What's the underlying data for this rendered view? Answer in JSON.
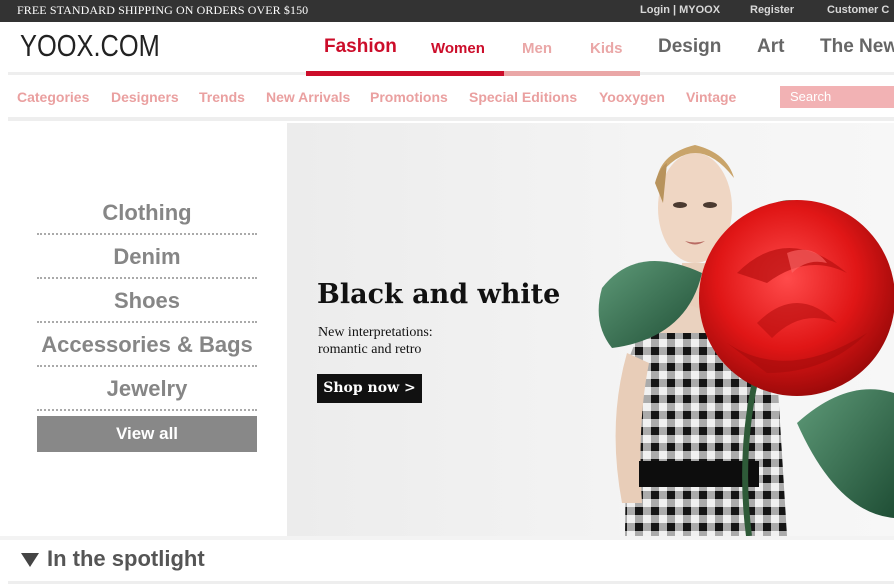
{
  "topbar": {
    "promo": "FREE STANDARD SHIPPING ON ORDERS OVER $150",
    "login": "Login | MYOOX",
    "register": "Register",
    "customer": "Customer C"
  },
  "header": {
    "logo": "YOOX.COM",
    "nav": {
      "fashion": "Fashion",
      "women": "Women",
      "men": "Men",
      "kids": "Kids",
      "design": "Design",
      "art": "Art",
      "new": "The New"
    }
  },
  "subnav": {
    "items": [
      "Categories",
      "Designers",
      "Trends",
      "New Arrivals",
      "Promotions",
      "Special Editions",
      "Yooxygen",
      "Vintage"
    ],
    "search_placeholder": "Search"
  },
  "categories": {
    "items": [
      "Clothing",
      "Denim",
      "Shoes",
      "Accessories & Bags",
      "Jewelry"
    ],
    "view_all": "View all"
  },
  "hero": {
    "title": "Black and white",
    "subtitle_line1": "New interpretations:",
    "subtitle_line2": "romantic and retro",
    "cta": "Shop now >"
  },
  "spotlight": {
    "title": "In the spotlight"
  },
  "colors": {
    "brand_red": "#cc0d2a",
    "pink": "#eaa7a7",
    "topbar": "#333333",
    "category_gray": "#868686"
  }
}
